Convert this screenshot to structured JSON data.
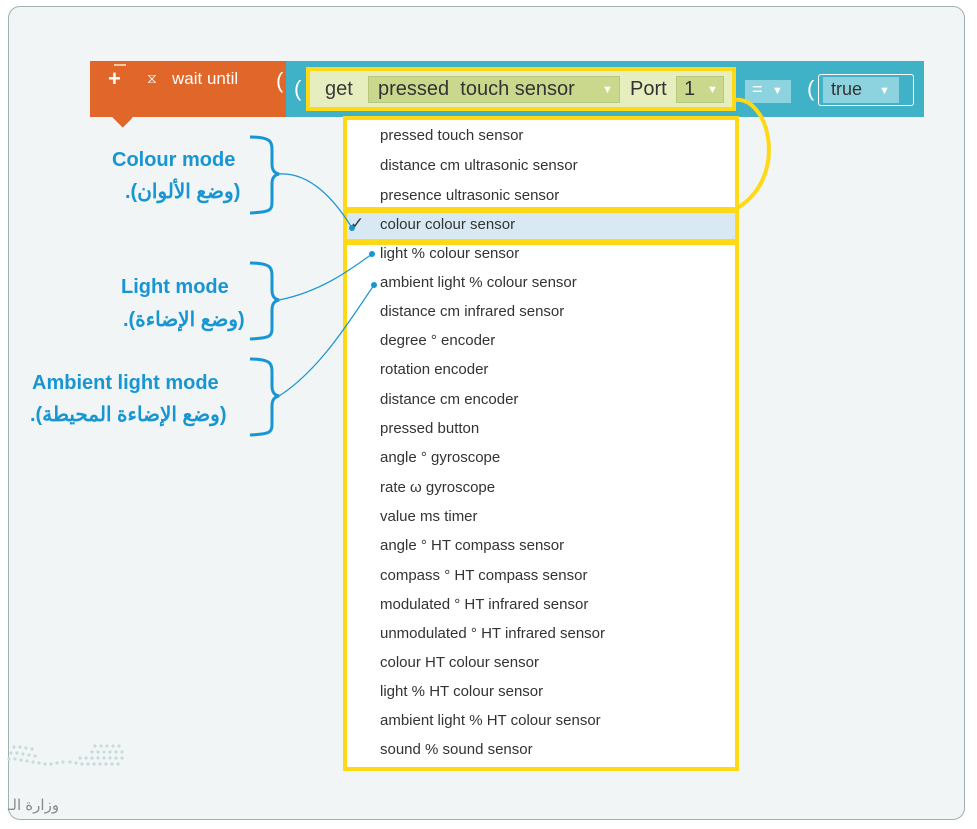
{
  "block": {
    "plus_icon": "+",
    "hourglass_icon": "⧖",
    "wait_label": "wait until",
    "get_label": "get",
    "sensor_selected": "pressed  touch sensor",
    "port_label": "Port",
    "port_value": "1",
    "operator_value": "=",
    "compare_value": "true",
    "dropdown_arrow": "▼"
  },
  "menu": {
    "check_icon": "✓",
    "selected_index": 3,
    "items": [
      "pressed touch sensor",
      "distance cm ultrasonic sensor",
      "presence ultrasonic sensor",
      "colour colour sensor",
      "light % colour sensor",
      "ambient light % colour sensor",
      "distance cm infrared sensor",
      "degree ° encoder",
      "rotation encoder",
      "distance cm encoder",
      "pressed button",
      "angle ° gyroscope",
      "rate ω gyroscope",
      "value ms timer",
      "angle ° HT compass sensor",
      "compass ° HT compass sensor",
      "modulated ° HT infrared sensor",
      "unmodulated ° HT infrared sensor",
      "colour HT colour sensor",
      "light % HT colour sensor",
      "ambient light % HT colour sensor",
      "sound % sound sensor"
    ]
  },
  "annotations": {
    "colour_mode": "Colour mode",
    "colour_mode_ar": "(وضع الألوان).",
    "light_mode": "Light mode",
    "light_mode_ar": "(وضع الإضاءة).",
    "ambient_mode": "Ambient light mode",
    "ambient_mode_ar": "(وضع الإضاءة المحيطة)."
  },
  "footer": {
    "ministry_text": "وزارة الـ"
  },
  "colors": {
    "wait_block": "#e0662a",
    "sensor_block": "#3fb2c7",
    "highlight": "#ffd816",
    "annotation": "#1895d3",
    "selected_row": "#d8e9f4"
  }
}
